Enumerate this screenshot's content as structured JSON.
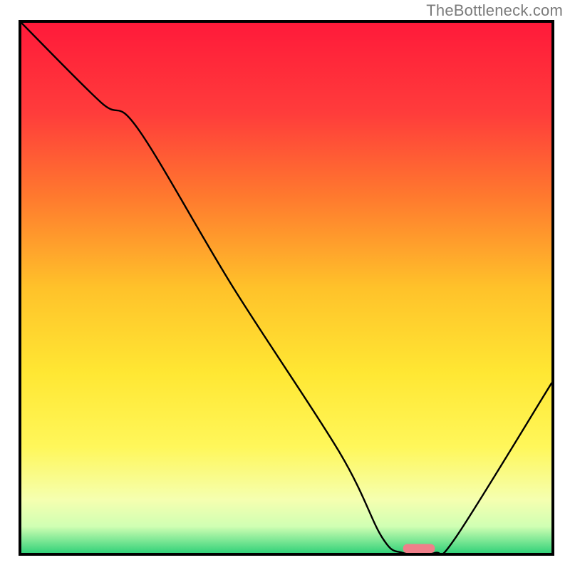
{
  "attribution": "TheBottleneck.com",
  "chart_data": {
    "type": "line",
    "title": "",
    "xlabel": "",
    "ylabel": "",
    "xlim": [
      0,
      100
    ],
    "ylim": [
      0,
      100
    ],
    "background": {
      "type": "vertical-gradient",
      "stops": [
        {
          "pos": 0,
          "color": "#ff1a3a"
        },
        {
          "pos": 17,
          "color": "#ff3c3b"
        },
        {
          "pos": 33,
          "color": "#ff7a2e"
        },
        {
          "pos": 50,
          "color": "#ffc22a"
        },
        {
          "pos": 66,
          "color": "#ffe733"
        },
        {
          "pos": 80,
          "color": "#fff75a"
        },
        {
          "pos": 90,
          "color": "#f5ffb0"
        },
        {
          "pos": 95,
          "color": "#d0ffb3"
        },
        {
          "pos": 100,
          "color": "#34d27a"
        }
      ]
    },
    "series": [
      {
        "name": "bottleneck-curve",
        "stroke": "#000000",
        "stroke_width": 2.4,
        "x": [
          0,
          15,
          22,
          40,
          60,
          68,
          72,
          78,
          82,
          100
        ],
        "values": [
          100,
          85,
          80,
          50,
          19,
          3,
          0,
          0,
          3,
          32
        ]
      }
    ],
    "marker": {
      "name": "sweet-spot",
      "x_center": 75,
      "width": 6,
      "y": 0,
      "color": "#f07f8a"
    }
  }
}
